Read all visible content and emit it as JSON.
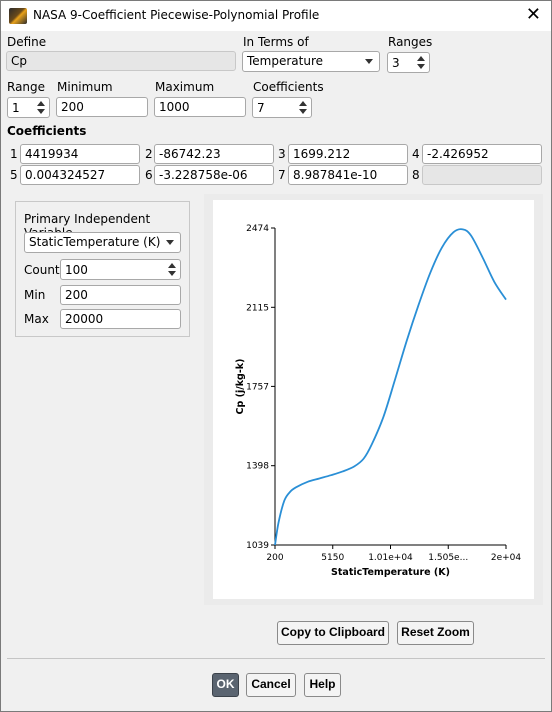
{
  "window": {
    "title": "NASA 9-Coefficient Piecewise-Polynomial Profile",
    "icon": "ansys-logo-icon",
    "close": "✕"
  },
  "define": {
    "label": "Define",
    "value": "Cp"
  },
  "in_terms_of": {
    "label": "In Terms of",
    "value": "Temperature"
  },
  "ranges": {
    "label": "Ranges",
    "value": "3"
  },
  "range": {
    "label": "Range",
    "value": "1"
  },
  "minimum": {
    "label": "Minimum",
    "value": "200"
  },
  "maximum": {
    "label": "Maximum",
    "value": "1000"
  },
  "coefficients_count": {
    "label": "Coefficients",
    "value": "7"
  },
  "coefficients": {
    "label": "Coefficients",
    "items": [
      {
        "index": "1",
        "value": "4419934"
      },
      {
        "index": "2",
        "value": "-86742.23"
      },
      {
        "index": "3",
        "value": "1699.212"
      },
      {
        "index": "4",
        "value": "-2.426952"
      },
      {
        "index": "5",
        "value": "0.004324527"
      },
      {
        "index": "6",
        "value": "-3.228758e-06"
      },
      {
        "index": "7",
        "value": "8.987841e-10"
      },
      {
        "index": "8",
        "value": ""
      }
    ]
  },
  "piv": {
    "title": "Primary Independent Variable",
    "variable": "StaticTemperature (K)",
    "count_label": "Count",
    "count": "100",
    "min_label": "Min",
    "min": "200",
    "max_label": "Max",
    "max": "20000"
  },
  "chart_data": {
    "type": "line",
    "xlabel": "StaticTemperature (K)",
    "ylabel": "Cp (j/kg-k)",
    "xlim": [
      200,
      20000
    ],
    "ylim": [
      1039,
      2474
    ],
    "x_ticks": [
      200,
      5150,
      10100,
      15050,
      20000
    ],
    "x_tick_labels": [
      "200",
      "5150",
      "1.01e+04",
      "1.505e...",
      "2e+04"
    ],
    "y_ticks": [
      1039,
      1398,
      1757,
      2115,
      2474
    ],
    "y_tick_labels": [
      "1039",
      "1398",
      "1757",
      "2115",
      "2474"
    ],
    "series": [
      {
        "color": "#2a8fd6",
        "x": [
          200,
          500,
          1000,
          1500,
          2000,
          3000,
          4000,
          5000,
          6000,
          7000,
          7800,
          8500,
          9500,
          10500,
          11500,
          12500,
          13500,
          14500,
          15500,
          16300,
          17000,
          18000,
          19000,
          20000
        ],
        "y": [
          1039,
          1140,
          1240,
          1280,
          1300,
          1325,
          1340,
          1355,
          1372,
          1395,
          1430,
          1495,
          1620,
          1790,
          1965,
          2125,
          2270,
          2385,
          2455,
          2468,
          2440,
          2340,
          2230,
          2150
        ]
      }
    ]
  },
  "buttons": {
    "copy": "Copy to Clipboard",
    "reset_zoom": "Reset Zoom",
    "ok": "OK",
    "cancel": "Cancel",
    "help": "Help"
  }
}
